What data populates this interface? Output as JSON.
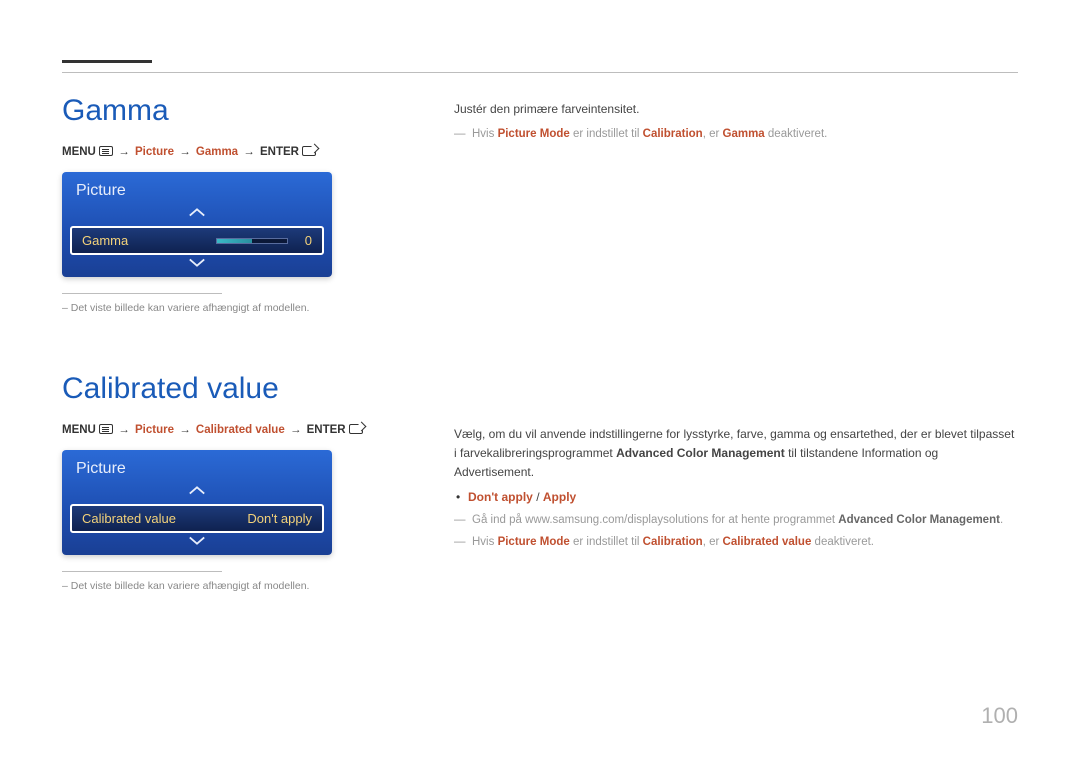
{
  "page_number": "100",
  "section1": {
    "title": "Gamma",
    "breadcrumb": {
      "menu": "MENU",
      "p2": "Picture",
      "p3": "Gamma",
      "enter": "ENTER"
    },
    "osd": {
      "title": "Picture",
      "item_label": "Gamma",
      "item_value": "0"
    },
    "footnote": "– Det viste billede kan variere afhængigt af modellen.",
    "desc": {
      "body": "Justér den primære farveintensitet.",
      "note1_a": "Hvis ",
      "note1_b": "Picture Mode",
      "note1_c": " er indstillet til ",
      "note1_d": "Calibration",
      "note1_e": ", er ",
      "note1_f": "Gamma",
      "note1_g": " deaktiveret."
    }
  },
  "section2": {
    "title": "Calibrated value",
    "breadcrumb": {
      "menu": "MENU",
      "p2": "Picture",
      "p3": "Calibrated value",
      "enter": "ENTER"
    },
    "osd": {
      "title": "Picture",
      "item_label": "Calibrated value",
      "item_value": "Don't apply"
    },
    "footnote": "– Det viste billede kan variere afhængigt af modellen.",
    "desc": {
      "body_a": "Vælg, om du vil anvende indstillingerne for lysstyrke, farve, gamma og ensartethed, der er blevet tilpasset i farvekalibreringsprogrammet ",
      "body_b": "Advanced Color Management",
      "body_c": " til tilstandene Information og Advertisement.",
      "opt1": "Don't apply",
      "opt_sep": " / ",
      "opt2": "Apply",
      "note2_a": "Gå ind på www.samsung.com/displaysolutions for at hente programmet ",
      "note2_b": "Advanced Color Management",
      "note2_c": ".",
      "note3_a": "Hvis ",
      "note3_b": "Picture Mode",
      "note3_c": " er indstillet til ",
      "note3_d": "Calibration",
      "note3_e": ", er ",
      "note3_f": "Calibrated value",
      "note3_g": " deaktiveret."
    }
  }
}
